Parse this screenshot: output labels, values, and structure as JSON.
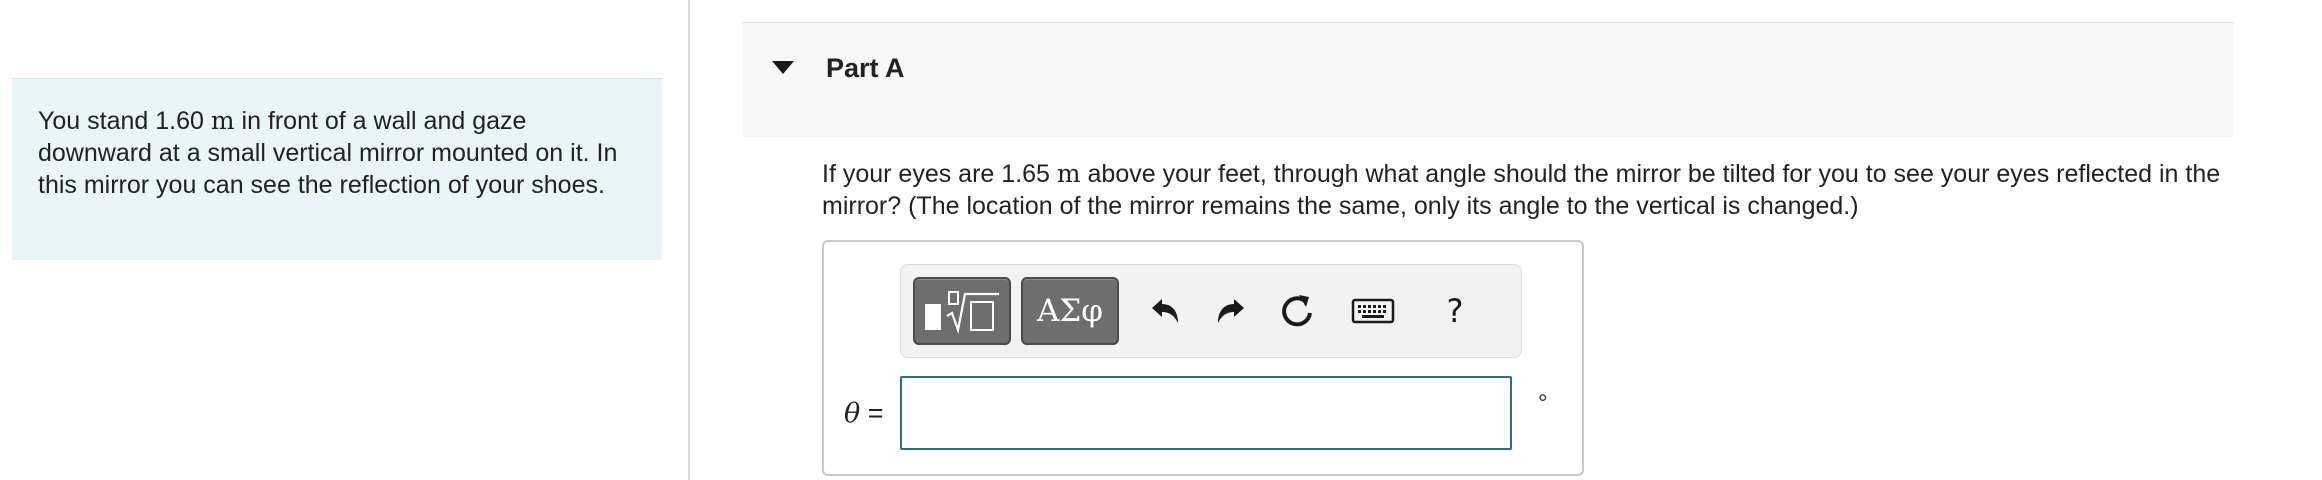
{
  "intro": {
    "text_before": "You stand 1.60 ",
    "unit": "m",
    "text_after": " in front of a wall and gaze downward at a small vertical mirror mounted on it. In this mirror you can see the reflection of your shoes."
  },
  "part": {
    "title": "Part A"
  },
  "question": {
    "text_before": "If your eyes are 1.65 ",
    "unit": "m",
    "text_after": " above your feet, through what angle should the mirror be tilted for you to see your eyes reflected in the mirror? (The location of the mirror remains the same, only its angle to the vertical is changed.)"
  },
  "toolbar": {
    "symbols_label": "ΑΣφ",
    "help_label": "?"
  },
  "answer": {
    "variable": "θ",
    "equals": " =",
    "value": "",
    "unit": "°"
  },
  "icons": {
    "part_toggle": "caret-down-icon",
    "templates": "templates-icon",
    "undo": "undo-icon",
    "redo": "redo-icon",
    "reset": "reset-icon",
    "keyboard": "keyboard-icon"
  },
  "colors": {
    "intro_bg": "#e9f5f7",
    "input_border": "#2b6f7a",
    "toolbar_button": "#6e6e6e"
  }
}
